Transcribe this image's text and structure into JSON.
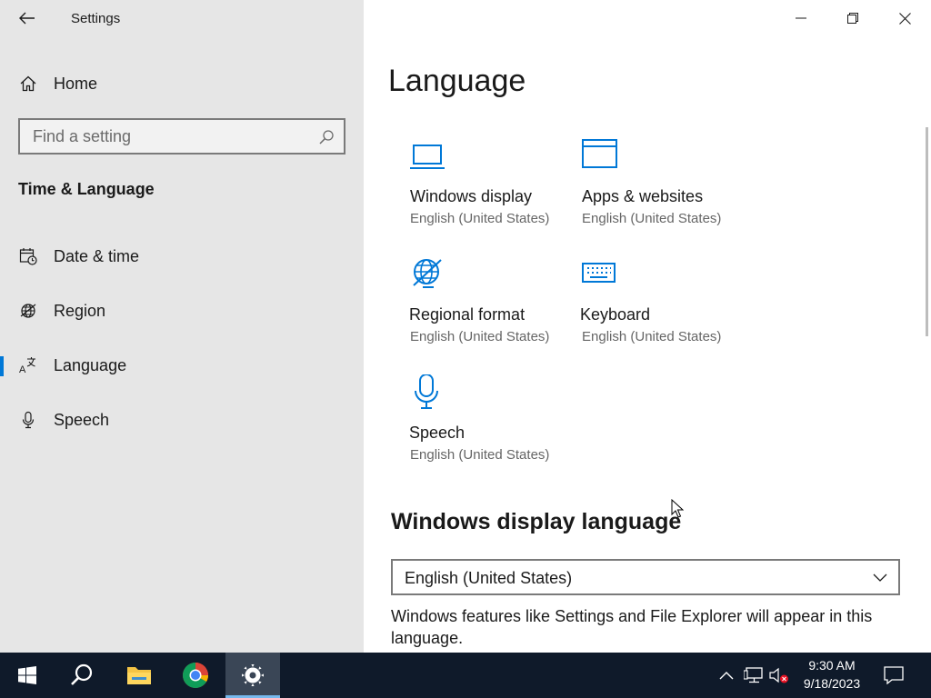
{
  "app": {
    "title": "Settings"
  },
  "sidebar": {
    "home_label": "Home",
    "search_placeholder": "Find a setting",
    "section_title": "Time & Language",
    "items": [
      {
        "label": "Date & time",
        "icon": "calendar-clock-icon"
      },
      {
        "label": "Region",
        "icon": "globe-icon"
      },
      {
        "label": "Language",
        "icon": "language-icon",
        "selected": true
      },
      {
        "label": "Speech",
        "icon": "microphone-icon"
      }
    ]
  },
  "main": {
    "title": "Language",
    "tiles": [
      {
        "title": "Windows display",
        "subtitle": "English (United States)",
        "icon": "laptop-icon"
      },
      {
        "title": "Apps & websites",
        "subtitle": "English (United States)",
        "icon": "window-icon"
      },
      {
        "title": "Regional format",
        "subtitle": "English (United States)",
        "icon": "globe-icon"
      },
      {
        "title": "Keyboard",
        "subtitle": "English (United States)",
        "icon": "keyboard-icon"
      },
      {
        "title": "Speech",
        "subtitle": "English (United States)",
        "icon": "microphone-icon"
      }
    ],
    "display_language": {
      "heading": "Windows display language",
      "selected": "English (United States)",
      "description": "Windows features like Settings and File Explorer will appear in this language."
    }
  },
  "taskbar": {
    "time": "9:30 AM",
    "date": "9/18/2023"
  },
  "colors": {
    "accent": "#0078d7",
    "sidebar_bg": "#e6e6e6",
    "taskbar_bg": "#0f1a2a"
  }
}
